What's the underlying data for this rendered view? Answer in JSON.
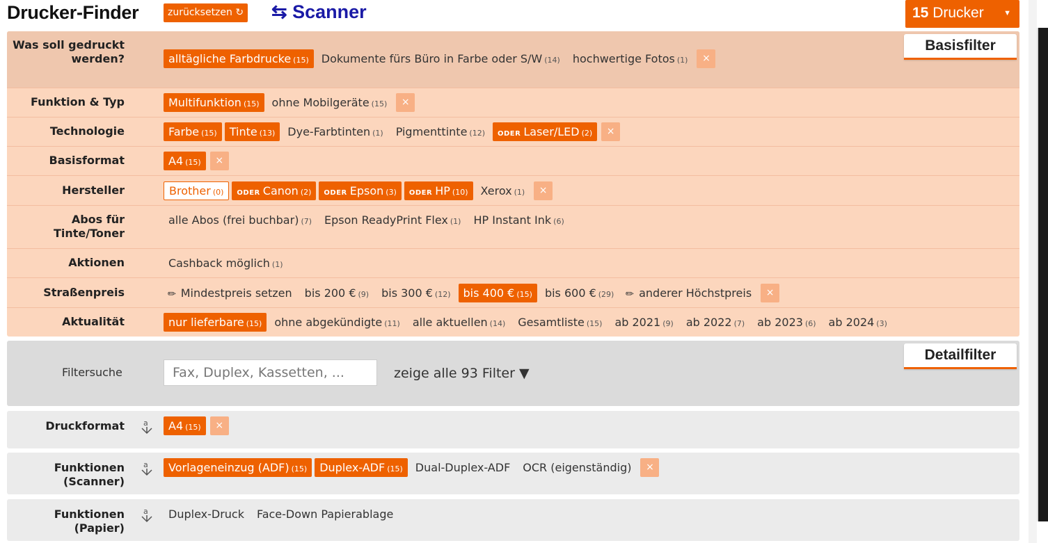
{
  "header": {
    "title": "Drucker-Finder",
    "reset_label": "zurücksetzen ↻",
    "scanner_label": "⇆ Scanner",
    "count_number": "15",
    "count_label": "Drucker",
    "count_caret": "▼"
  },
  "basisfilter": {
    "tab_label": "Basisfilter",
    "rows": [
      {
        "label": "Was soll gedruckt werden?",
        "items": [
          {
            "text": "alltägliche Farbdrucke",
            "count": "(15)",
            "selected": true
          },
          {
            "text": "Dokumente fürs Büro in Farbe oder S/W",
            "count": "(14)"
          },
          {
            "text": "hochwertige Fotos",
            "count": "(1)"
          }
        ],
        "clear": "×"
      },
      {
        "label": "Funktion & Typ",
        "items": [
          {
            "text": "Multifunktion",
            "count": "(15)",
            "selected": true
          },
          {
            "text": "ohne Mobilgeräte",
            "count": "(15)"
          }
        ],
        "clear": "×"
      },
      {
        "label": "Technologie",
        "items": [
          {
            "text": "Farbe",
            "count": "(15)",
            "selected": true
          },
          {
            "text": "Tinte",
            "count": "(13)",
            "selected": true
          },
          {
            "text": "Dye-Farbtinten",
            "count": "(1)"
          },
          {
            "text": "Pigmenttinte",
            "count": "(12)"
          },
          {
            "prefix": "ODER",
            "text": "Laser/LED",
            "count": "(2)",
            "selected": true
          }
        ],
        "clear": "×"
      },
      {
        "label": "Basisformat",
        "items": [
          {
            "text": "A4",
            "count": "(15)",
            "selected": true
          }
        ],
        "clear": "×"
      },
      {
        "label": "Hersteller",
        "items": [
          {
            "text": "Brother",
            "count": "(0)",
            "outline": true
          },
          {
            "prefix": "ODER",
            "text": "Canon",
            "count": "(2)",
            "selected": true
          },
          {
            "prefix": "ODER",
            "text": "Epson",
            "count": "(3)",
            "selected": true
          },
          {
            "prefix": "ODER",
            "text": "HP",
            "count": "(10)",
            "selected": true
          },
          {
            "text": "Xerox",
            "count": "(1)"
          }
        ],
        "clear": "×"
      },
      {
        "label": "Abos für Tinte/Toner",
        "items": [
          {
            "text": "alle Abos (frei buchbar)",
            "count": "(7)"
          },
          {
            "text": "Epson ReadyPrint Flex",
            "count": "(1)"
          },
          {
            "text": "HP Instant Ink",
            "count": "(6)"
          }
        ]
      },
      {
        "label": "Aktionen",
        "items": [
          {
            "text": "Cashback möglich",
            "count": "(1)"
          }
        ]
      },
      {
        "label": "Straßenpreis",
        "items": [
          {
            "icon": "pencil",
            "text": "Mindestpreis setzen"
          },
          {
            "text": "bis 200 €",
            "count": "(9)"
          },
          {
            "text": "bis 300 €",
            "count": "(12)"
          },
          {
            "text": "bis 400 €",
            "count": "(15)",
            "selected": true
          },
          {
            "text": "bis 600 €",
            "count": "(29)"
          },
          {
            "icon": "pencil",
            "text": "anderer Höchstpreis"
          }
        ],
        "clear": "×"
      },
      {
        "label": "Aktualität",
        "items": [
          {
            "text": "nur lieferbare",
            "count": "(15)",
            "selected": true
          },
          {
            "text": "ohne abgekündigte",
            "count": "(11)"
          },
          {
            "text": "alle aktuellen",
            "count": "(14)"
          },
          {
            "text": "Gesamtliste",
            "count": "(15)"
          },
          {
            "text": "ab 2021",
            "count": "(9)"
          },
          {
            "text": "ab 2022",
            "count": "(7)"
          },
          {
            "text": "ab 2023",
            "count": "(6)"
          },
          {
            "text": "ab 2024",
            "count": "(3)"
          }
        ]
      }
    ]
  },
  "detailfilter": {
    "tab_label": "Detailfilter",
    "search_label": "Filtersuche",
    "search_placeholder": "Fax, Duplex, Kassetten, ...",
    "show_all_label": "zeige alle 93 Filter ▼"
  },
  "detail_rows": [
    {
      "label": "Druckformat",
      "items": [
        {
          "text": "A4",
          "count": "(15)",
          "selected": true
        }
      ],
      "clear": "×"
    },
    {
      "label": "Funktionen (Scanner)",
      "items": [
        {
          "text": "Vorlageneinzug (ADF)",
          "count": "(15)",
          "selected": true
        },
        {
          "text": "Duplex-ADF",
          "count": "(15)",
          "selected": true
        },
        {
          "text": "Dual-Duplex-ADF"
        },
        {
          "text": "OCR (eigenständig)"
        }
      ],
      "clear": "×"
    },
    {
      "label": "Funktionen (Papier)",
      "items": [
        {
          "text": "Duplex-Druck"
        },
        {
          "text": "Face-Down Papierablage"
        }
      ]
    }
  ],
  "colors": {
    "accent": "#ee6100",
    "panel": "#fcd6bd",
    "scanner_link": "#1a1aa6"
  }
}
